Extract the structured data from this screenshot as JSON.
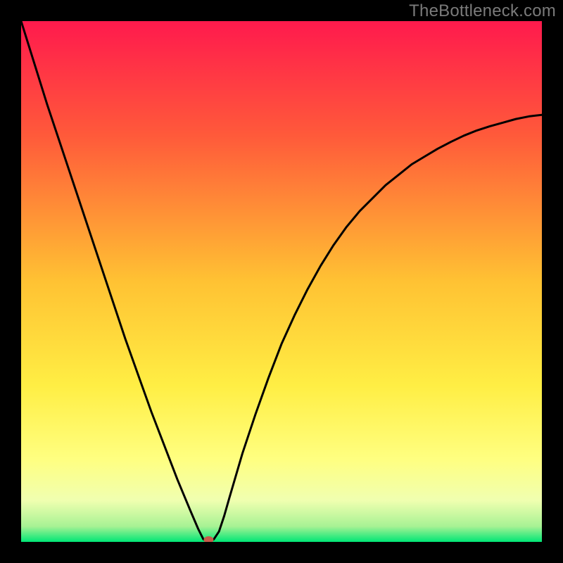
{
  "watermark": "TheBottleneck.com",
  "chart_data": {
    "type": "line",
    "title": "",
    "xlabel": "",
    "ylabel": "",
    "xlim": [
      0,
      100
    ],
    "ylim": [
      0,
      100
    ],
    "grid": false,
    "background_gradient": [
      "#ff1a4d",
      "#ff6a33",
      "#ffd933",
      "#ffff66",
      "#f5ffc0",
      "#00e676"
    ],
    "series": [
      {
        "name": "bottleneck-curve",
        "color": "#000000",
        "x": [
          0,
          2.5,
          5,
          7.5,
          10,
          12.5,
          15,
          17.5,
          20,
          22.5,
          25,
          27.5,
          30,
          32.5,
          34,
          35,
          36,
          37,
          38,
          39,
          40,
          42.5,
          45,
          47.5,
          50,
          52.5,
          55,
          57.5,
          60,
          62.5,
          65,
          67.5,
          70,
          72.5,
          75,
          77.5,
          80,
          82.5,
          85,
          87.5,
          90,
          92.5,
          95,
          97.5,
          100
        ],
        "y": [
          100,
          92,
          84,
          76.5,
          69,
          61.5,
          54,
          46.5,
          39,
          32,
          25,
          18.5,
          12,
          6,
          2.5,
          0.5,
          0,
          0.5,
          2,
          5,
          8.5,
          17,
          24.5,
          31.5,
          38,
          43.5,
          48.5,
          53,
          57,
          60.5,
          63.5,
          66,
          68.5,
          70.5,
          72.5,
          74,
          75.5,
          76.8,
          78,
          79,
          79.8,
          80.5,
          81.2,
          81.7,
          82
        ]
      }
    ],
    "marker": {
      "name": "optimal-point",
      "x": 36,
      "y": 0,
      "color": "#c85a4a"
    }
  }
}
